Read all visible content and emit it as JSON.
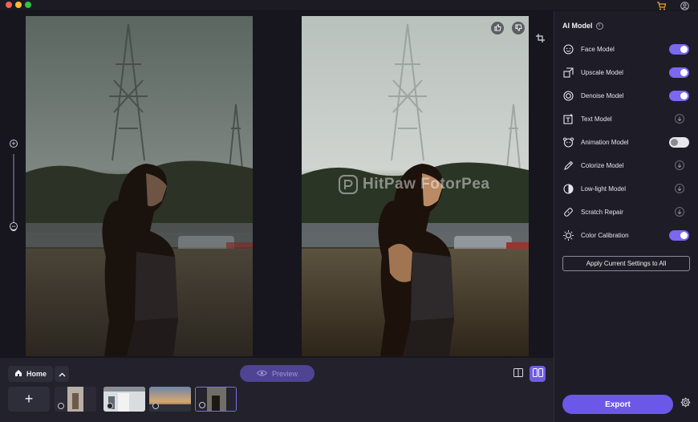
{
  "window": {
    "traffic_lights": [
      "close",
      "minimize",
      "zoom"
    ],
    "icons": {
      "cart": "cart-icon",
      "account": "account-icon"
    }
  },
  "canvas": {
    "watermark": "HitPaw FotorPea",
    "zoom": {
      "in_symbol": "+",
      "out_symbol": "−"
    },
    "feedback": {
      "like": "thumbs-up-icon",
      "dislike": "thumbs-down-icon"
    },
    "crop_icon": "crop-icon"
  },
  "bottom_bar": {
    "home_label": "Home",
    "preview_label": "Preview",
    "add_symbol": "+",
    "views": {
      "single": "single-view-icon",
      "split": "split-view-icon",
      "active": "split"
    },
    "accent": "#6f5ce6"
  },
  "panel": {
    "title": "AI Model",
    "models": [
      {
        "label": "Face Model",
        "icon": "face-icon",
        "control": "toggle",
        "on": true
      },
      {
        "label": "Upscale Model",
        "icon": "upscale-icon",
        "control": "toggle",
        "on": true
      },
      {
        "label": "Denoise Model",
        "icon": "denoise-icon",
        "control": "toggle",
        "on": true
      },
      {
        "label": "Text Model",
        "icon": "text-model-icon",
        "control": "expand",
        "on": false
      },
      {
        "label": "Animation Model",
        "icon": "animation-icon",
        "control": "toggle",
        "on": false
      },
      {
        "label": "Colorize Model",
        "icon": "colorize-icon",
        "control": "expand",
        "on": false
      },
      {
        "label": "Low-light Model",
        "icon": "low-light-icon",
        "control": "expand",
        "on": false
      },
      {
        "label": "Scratch Repair",
        "icon": "scratch-repair-icon",
        "control": "expand",
        "on": false
      },
      {
        "label": "Color Calibration",
        "icon": "color-calibration-icon",
        "control": "toggle",
        "on": true
      }
    ],
    "apply_label": "Apply Current Settings to All",
    "export_label": "Export",
    "export_color": "#6b57e8"
  }
}
